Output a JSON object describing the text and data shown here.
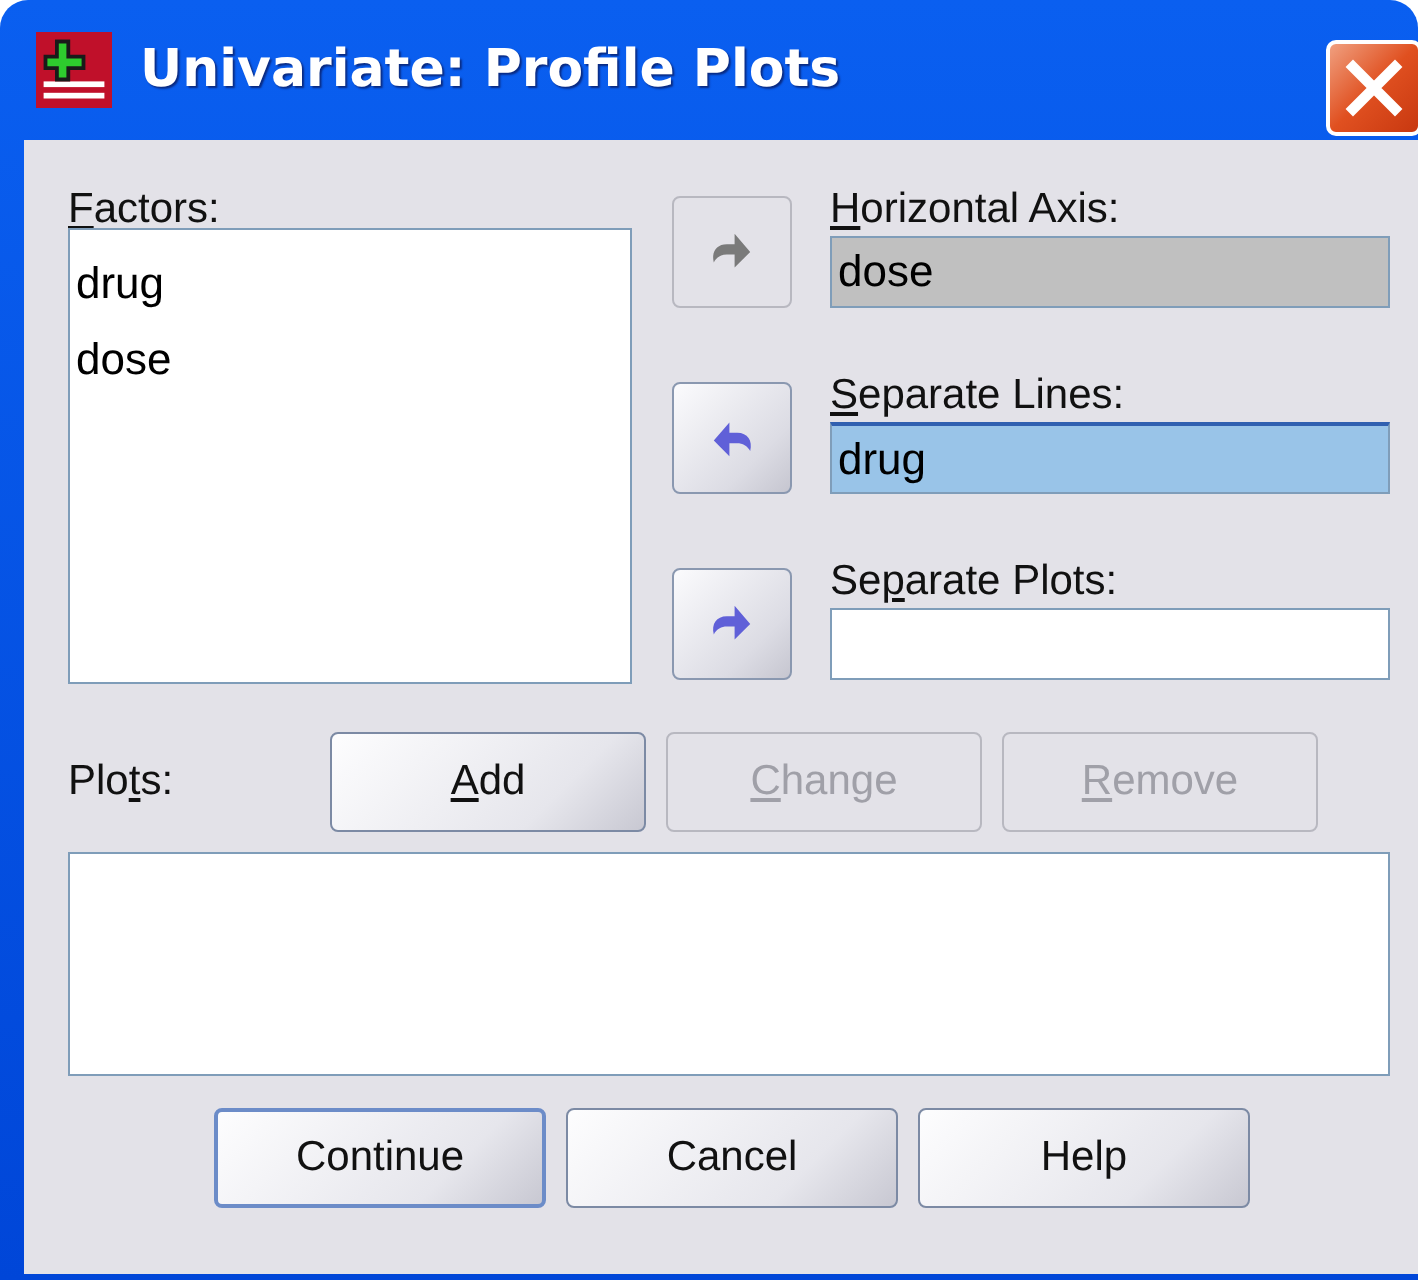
{
  "window": {
    "title": "Univariate: Profile Plots"
  },
  "factors": {
    "label": {
      "key": "F",
      "rest": "actors:"
    },
    "items": [
      {
        "text": "drug",
        "selected": false
      },
      {
        "text": "dose",
        "selected": false
      }
    ]
  },
  "targets": [
    {
      "label": {
        "key": "H",
        "rest": "orizontal Axis:"
      },
      "value": "dose",
      "disabled": true,
      "selected": false,
      "arrow": {
        "kind": "right",
        "disabled": true
      }
    },
    {
      "label": {
        "key": "S",
        "rest": "eparate Lines:"
      },
      "value": "drug",
      "disabled": false,
      "selected": true,
      "arrow": {
        "kind": "left",
        "disabled": false
      }
    },
    {
      "label": {
        "pre": "Se",
        "key": "p",
        "rest": "arate Plots:"
      },
      "disabled": false,
      "selected": false,
      "arrow": {
        "kind": "right",
        "disabled": false
      }
    }
  ],
  "plots": {
    "label": {
      "pre": "Plo",
      "key": "t",
      "rest": "s:"
    },
    "buttons": [
      {
        "label": {
          "key": "A",
          "rest": "dd"
        },
        "disabled": false
      },
      {
        "label": {
          "key": "C",
          "rest": "hange"
        },
        "disabled": true
      },
      {
        "label": {
          "key": "R",
          "rest": "emove"
        },
        "disabled": true
      }
    ]
  },
  "buttons": [
    {
      "label": "Continue",
      "default": true
    },
    {
      "label": "Cancel",
      "default": false
    },
    {
      "label": "Help",
      "default": false
    }
  ]
}
